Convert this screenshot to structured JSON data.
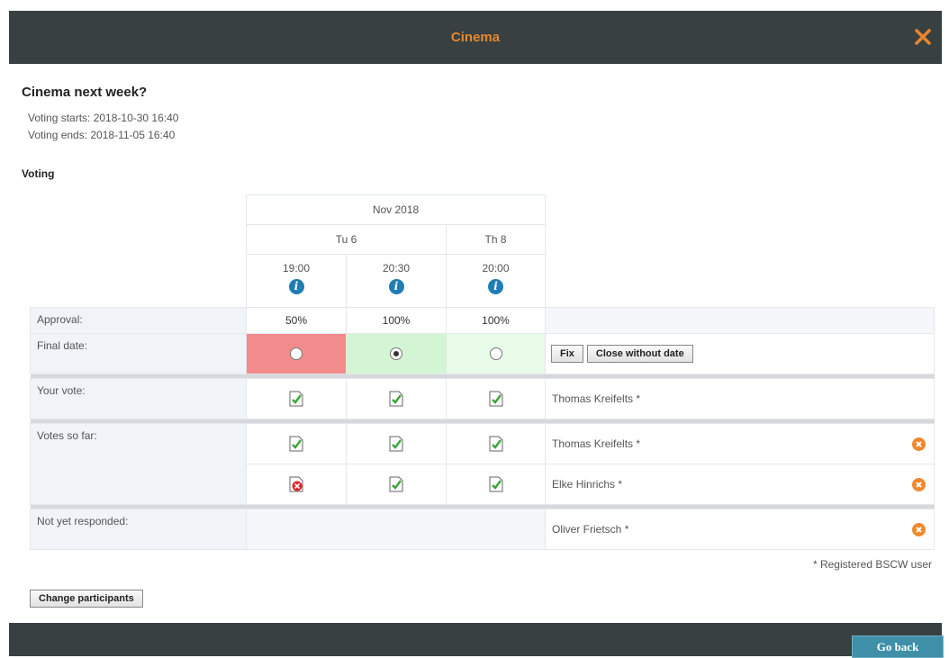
{
  "window": {
    "title": "Cinema"
  },
  "poll": {
    "heading": "Cinema next week?",
    "voting_starts": "Voting starts: 2018-10-30 16:40",
    "voting_ends": "Voting ends: 2018-11-05 16:40",
    "section_title": "Voting",
    "month": "Nov 2018",
    "days": [
      "Tu 6",
      "Th 8"
    ],
    "times": [
      "19:00",
      "20:30",
      "20:00"
    ],
    "approval_label": "Approval:",
    "approval": [
      "50%",
      "100%",
      "100%"
    ],
    "final_date_label": "Final date:",
    "final_date_colors": [
      "#f28b8b",
      "#d3f5d3",
      "#e8fae8"
    ],
    "fix_button": "Fix",
    "close_without_date_button": "Close without date",
    "your_vote_label": "Your vote:",
    "your_vote_name": "Thomas Kreifelts *",
    "votes_so_far_label": "Votes so far:",
    "voters": [
      {
        "name": "Thomas Kreifelts *",
        "votes": [
          "yes",
          "yes",
          "yes"
        ]
      },
      {
        "name": "Elke Hinrichs *",
        "votes": [
          "no",
          "yes",
          "yes"
        ]
      }
    ],
    "not_yet_label": "Not yet responded:",
    "not_yet_name": "Oliver Frietsch *",
    "footnote": "* Registered BSCW user",
    "change_participants_button": "Change participants",
    "go_back_button": "Go back"
  },
  "colors": {
    "accent": "#e8862e",
    "bar": "#384042",
    "info": "#1f7db3",
    "go_back": "#3f8fa8"
  }
}
